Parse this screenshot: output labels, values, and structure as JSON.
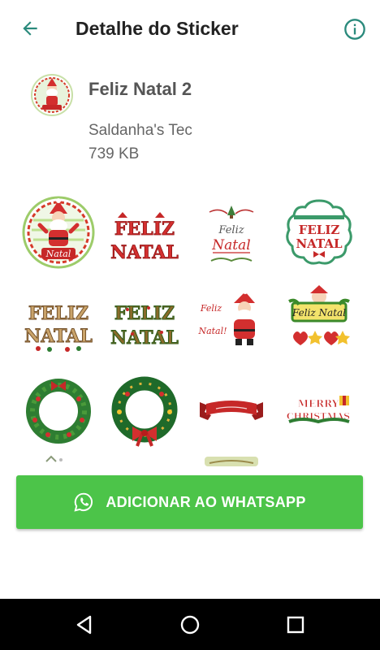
{
  "appbar": {
    "title": "Detalhe do Sticker",
    "back_icon": "arrow-left-icon",
    "info_icon": "info-circle-icon"
  },
  "pack": {
    "name": "Feliz Natal 2",
    "publisher": "Saldanha's Tec",
    "size": "739 KB"
  },
  "stickers": [
    {
      "id": "santa-round-badge",
      "text": "Natal"
    },
    {
      "id": "feliz-natal-red-letters",
      "text": "FELIZ NATAL"
    },
    {
      "id": "feliz-natal-script",
      "text": "Feliz Natal"
    },
    {
      "id": "feliz-natal-scalloped-badge",
      "text": "FELIZ NATAL"
    },
    {
      "id": "feliz-natal-wooden-letters",
      "text": "FELIZ NATAL"
    },
    {
      "id": "feliz-natal-festive-letters",
      "text": "FELIZ NATAL"
    },
    {
      "id": "feliz-natal-santa",
      "text": "Feliz Natal"
    },
    {
      "id": "feliz-natal-santa-sign",
      "text": "Feliz Natal"
    },
    {
      "id": "christmas-wreath-red",
      "text": ""
    },
    {
      "id": "christmas-wreath-bow",
      "text": ""
    },
    {
      "id": "red-ribbon-banner",
      "text": ""
    },
    {
      "id": "merry-christmas-banner",
      "text": "MERRY CHRISTMAS"
    },
    {
      "id": "partial-sticker-1",
      "text": ""
    },
    {
      "id": "partial-sticker-2",
      "text": ""
    }
  ],
  "add_button": {
    "label": "ADICIONAR AO WHATSAPP",
    "icon": "whatsapp-icon"
  },
  "navbar": {
    "back_icon": "nav-back-triangle-icon",
    "home_icon": "nav-home-circle-icon",
    "recent_icon": "nav-recent-square-icon"
  },
  "colors": {
    "accent": "#2a8a7c",
    "add_button": "#4cc449",
    "navbar": "#000000"
  }
}
